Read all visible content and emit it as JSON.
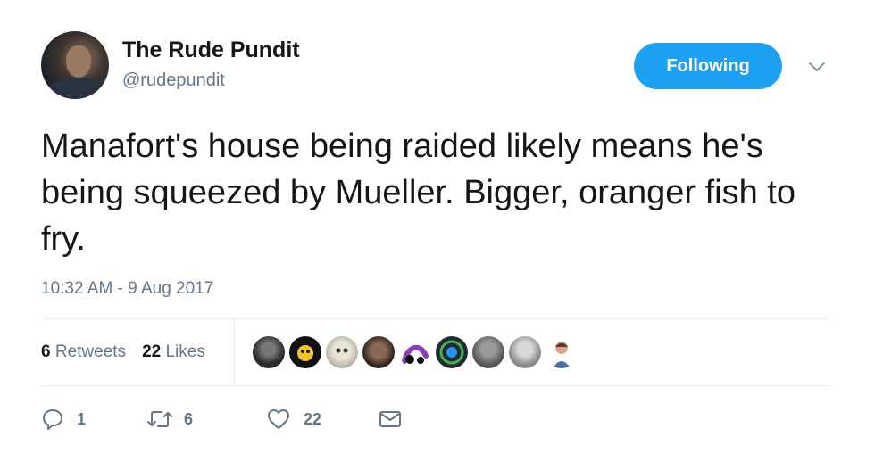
{
  "author": {
    "display_name": "The Rude Pundit",
    "handle": "@rudepundit"
  },
  "follow_button": {
    "label": "Following"
  },
  "tweet": {
    "text": "Manafort's house being raided likely means he's being squeezed by Mueller. Bigger, oranger fish to fry.",
    "timestamp": "10:32 AM - 9 Aug 2017"
  },
  "stats": {
    "retweets_count": "6",
    "retweets_label": "Retweets",
    "likes_count": "22",
    "likes_label": "Likes"
  },
  "actions": {
    "reply_count": "1",
    "retweet_count": "6",
    "like_count": "22"
  },
  "colors": {
    "accent": "#1da1f2",
    "muted_text": "#657786",
    "primary_text": "#14171a",
    "divider": "#e6ecf0"
  },
  "icons": [
    "user-avatar",
    "chevron-down-icon",
    "reply-icon",
    "retweet-icon",
    "like-icon",
    "direct-message-icon"
  ]
}
